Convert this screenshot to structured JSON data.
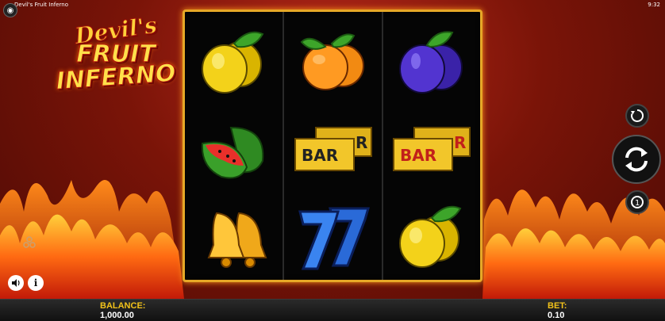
{
  "topbar": {
    "title": "Devil's Fruit Inferno",
    "time": "9:32"
  },
  "logo": {
    "line1": "Devil's",
    "line2": "FRUIT",
    "line3": "INFERNO"
  },
  "reels": [
    [
      "lemon",
      "watermelon",
      "bells"
    ],
    [
      "orange",
      "bar",
      "seven"
    ],
    [
      "plum",
      "bar",
      "lemon"
    ]
  ],
  "symbols": {
    "bar_text": "BAR",
    "bar_text_back": "R"
  },
  "controls": {
    "autoplay_icon": "autoplay-icon",
    "spin_icon": "spin-icon",
    "coin_icon": "coin-icon",
    "sound_icon": "speaker-icon",
    "info_label": "i",
    "history_icon": "history-icon"
  },
  "footer": {
    "balance_label": "BALANCE:",
    "balance_value": "1,000.00",
    "bet_label": "BET:",
    "bet_value": "0.10"
  },
  "colors": {
    "frame": "#e6a827",
    "label": "#f2c21a",
    "background": "#7a1408"
  }
}
